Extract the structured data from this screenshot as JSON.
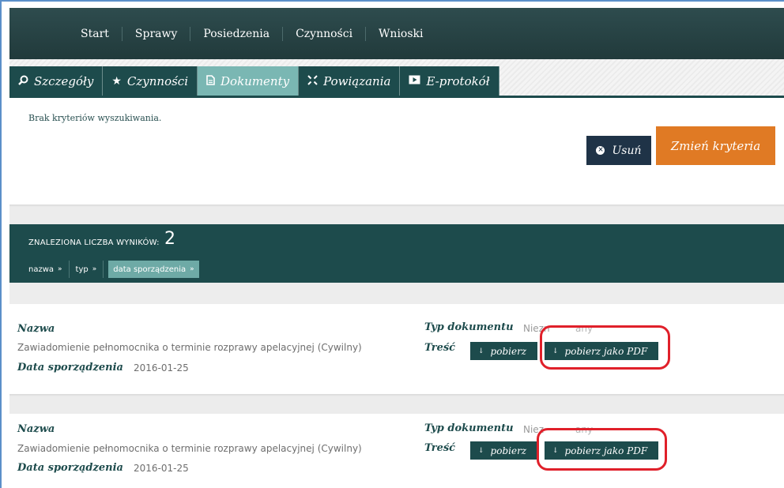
{
  "topnav": {
    "items": [
      "Start",
      "Sprawy",
      "Posiedzenia",
      "Czynności",
      "Wnioski"
    ]
  },
  "tabs": [
    {
      "label": "Szczegóły",
      "icon": "search-icon",
      "active": false
    },
    {
      "label": "Czynności",
      "icon": "star-icon",
      "active": false
    },
    {
      "label": "Dokumenty",
      "icon": "document-icon",
      "active": true
    },
    {
      "label": "Powiązania",
      "icon": "link-icon",
      "active": false
    },
    {
      "label": "E-protokół",
      "icon": "play-icon",
      "active": false
    }
  ],
  "criteria": {
    "no_criteria_text": "Brak kryteriów wyszukiwania.",
    "remove_label": "Usuń",
    "change_label": "Zmień kryteria"
  },
  "results": {
    "count_label": "ZNALEZIONA LICZBA WYNIKÓW:",
    "count": "2",
    "sorts": [
      {
        "label": "nazwa",
        "active": false
      },
      {
        "label": "typ",
        "active": false
      },
      {
        "label": "data sporządzenia",
        "active": true
      }
    ]
  },
  "documents": [
    {
      "name_label": "Nazwa",
      "name": "Zawiadomienie pełnomocnika o terminie rozprawy apelacyjnej (Cywilny)",
      "date_label": "Data sporządzenia",
      "date": "2016-01-25",
      "type_label": "Typ dokumentu",
      "type_value": "Niezn",
      "type_value_tail": "any",
      "content_label": "Treść",
      "download_label": "pobierz",
      "download_pdf_label": "pobierz jako PDF"
    },
    {
      "name_label": "Nazwa",
      "name": "Zawiadomienie pełnomocnika o terminie rozprawy apelacyjnej (Cywilny)",
      "date_label": "Data sporządzenia",
      "date": "2016-01-25",
      "type_label": "Typ dokumentu",
      "type_value": "Niez",
      "type_value_tail": "any",
      "content_label": "Treść",
      "download_label": "pobierz",
      "download_pdf_label": "pobierz jako PDF"
    }
  ],
  "colors": {
    "primary": "#1d4b4c",
    "active_tab": "#7ab7b3",
    "accent_orange": "#e07a24",
    "remove_button": "#1f3347",
    "highlight_ring": "#e0202a"
  }
}
